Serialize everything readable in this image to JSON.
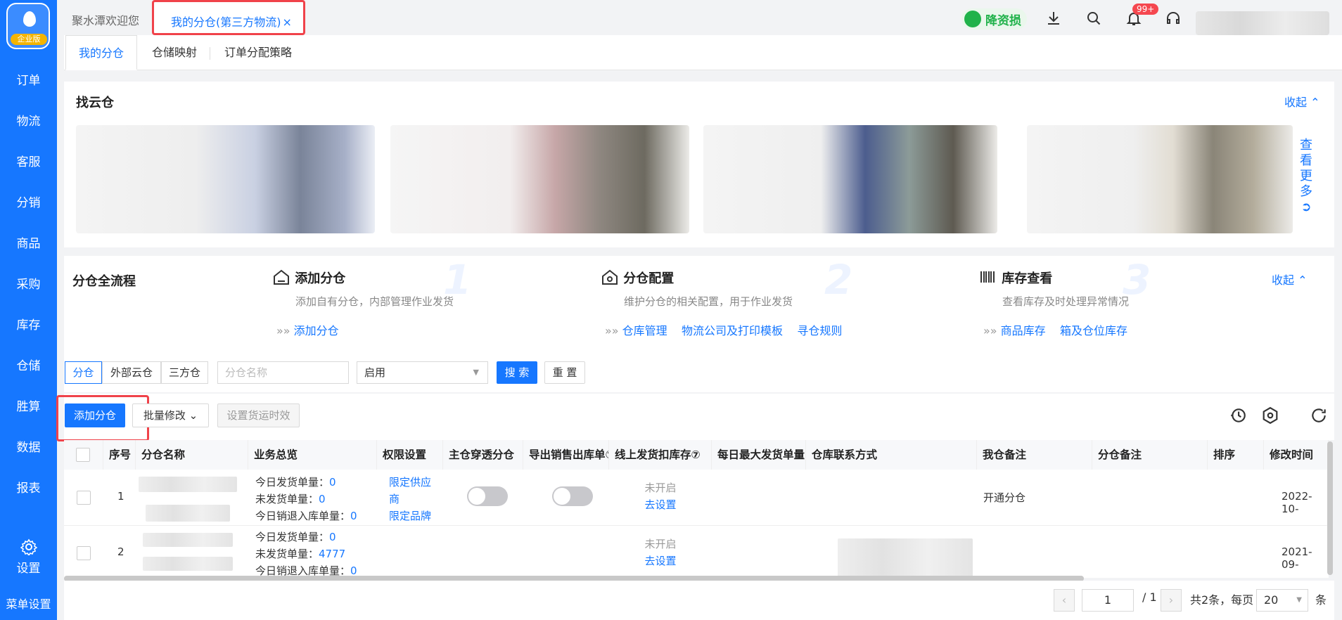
{
  "sidebar": {
    "logo_badge": "企业版",
    "items": [
      "订单",
      "物流",
      "客服",
      "分销",
      "商品",
      "采购",
      "库存",
      "仓储",
      "胜算",
      "数据",
      "报表"
    ],
    "settings_label": "设置",
    "menu_settings_label": "菜单设置"
  },
  "topbar": {
    "welcome_tab": "聚水潭欢迎您",
    "active_tab": "我的分仓(第三方物流)",
    "close_symbol": "×",
    "subsidy_label": "降资损",
    "notification_count": "99+"
  },
  "subtabs": [
    "我的分仓",
    "仓储映射",
    "订单分配策略"
  ],
  "cloud_section": {
    "title": "找云仓",
    "collapse_label": "收起",
    "more_label": [
      "查",
      "看",
      "更",
      "多"
    ]
  },
  "flow_section": {
    "title": "分仓全流程",
    "collapse_label": "收起",
    "steps": [
      {
        "title": "添加分仓",
        "desc": "添加自有分仓，内部管理作业发货",
        "links": [
          "添加分仓"
        ],
        "num": "1"
      },
      {
        "title": "分仓配置",
        "desc": "维护分仓的相关配置，用于作业发货",
        "links": [
          "仓库管理",
          "物流公司及打印模板",
          "寻仓规则"
        ],
        "num": "2"
      },
      {
        "title": "库存查看",
        "desc": "查看库存及时处理异常情况",
        "links": [
          "商品库存",
          "箱及仓位库存"
        ],
        "num": "3"
      }
    ]
  },
  "filters": {
    "segments": [
      "分仓",
      "外部云仓",
      "三方仓"
    ],
    "name_placeholder": "分仓名称",
    "status_value": "启用",
    "search_label": "搜 索",
    "reset_label": "重 置"
  },
  "actions": {
    "add_label": "添加分仓",
    "batch_label": "批量修改",
    "shipping_label": "设置货运时效"
  },
  "table": {
    "columns": [
      "序号",
      "分仓名称",
      "业务总览",
      "权限设置",
      "主仓穿透分仓",
      "导出销售出库单⑦",
      "线上发货扣库存⑦",
      "每日最大发货单量",
      "仓库联系方式",
      "我仓备注",
      "分仓备注",
      "排序",
      "修改时间"
    ],
    "rows": [
      {
        "seq": "1",
        "overview": [
          {
            "label": "今日发货单量：",
            "value": "0"
          },
          {
            "label": "未发货单量：",
            "value": "0"
          },
          {
            "label": "今日销退入库单量：",
            "value": "0"
          }
        ],
        "permissions": [
          "限定供应",
          "商",
          "限定品牌"
        ],
        "deduct_status": "未开启",
        "deduct_link": "去设置",
        "my_note": "开通分仓",
        "modified": "2022-10-"
      },
      {
        "seq": "2",
        "overview": [
          {
            "label": "今日发货单量：",
            "value": "0"
          },
          {
            "label": "未发货单量：",
            "value": "4777"
          },
          {
            "label": "今日销退入库单量：",
            "value": "0"
          }
        ],
        "permissions": [],
        "deduct_status": "未开启",
        "deduct_link": "去设置",
        "my_note": "",
        "modified": "2021-09-"
      }
    ]
  },
  "pager": {
    "current_page": "1",
    "total_pages": "/ 1",
    "summary": "共2条，每页",
    "page_size": "20",
    "unit": "条"
  },
  "colors": {
    "primary": "#1677ff",
    "highlight": "#f0424a",
    "sidebar": "#1677ff"
  }
}
